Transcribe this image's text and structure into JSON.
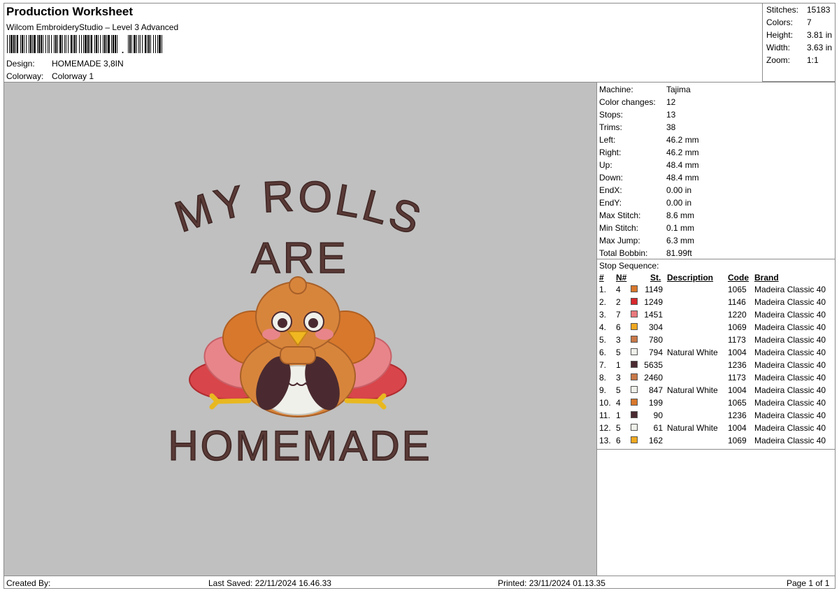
{
  "header": {
    "title": "Production Worksheet",
    "software": "Wilcom EmbroideryStudio – Level 3 Advanced",
    "design_label": "Design:",
    "design_value": "HOMEMADE 3,8IN",
    "colorway_label": "Colorway:",
    "colorway_value": "Colorway 1"
  },
  "summary": [
    {
      "label": "Stitches:",
      "value": "15183"
    },
    {
      "label": "Colors:",
      "value": "7"
    },
    {
      "label": "Height:",
      "value": "3.81 in"
    },
    {
      "label": "Width:",
      "value": "3.63 in"
    },
    {
      "label": "Zoom:",
      "value": "1:1"
    }
  ],
  "machine_info": [
    {
      "label": "Machine:",
      "value": "Tajima"
    },
    {
      "label": "Color changes:",
      "value": "12"
    },
    {
      "label": "Stops:",
      "value": "13"
    },
    {
      "label": "Trims:",
      "value": "38"
    },
    {
      "label": "Left:",
      "value": "46.2 mm"
    },
    {
      "label": "Right:",
      "value": "46.2 mm"
    },
    {
      "label": "Up:",
      "value": "48.4 mm"
    },
    {
      "label": "Down:",
      "value": "48.4 mm"
    },
    {
      "label": "EndX:",
      "value": "0.00 in"
    },
    {
      "label": "EndY:",
      "value": "0.00 in"
    },
    {
      "label": "Max Stitch:",
      "value": "8.6 mm"
    },
    {
      "label": "Min Stitch:",
      "value": "0.1 mm"
    },
    {
      "label": "Max Jump:",
      "value": "6.3 mm"
    },
    {
      "label": "Total Bobbin:",
      "value": "81.99ft"
    }
  ],
  "stop_sequence": {
    "title": "Stop Sequence:",
    "columns": {
      "num": "#",
      "n": "N#",
      "st": "St.",
      "desc": "Description",
      "code": "Code",
      "brand": "Brand"
    },
    "rows": [
      {
        "num": "1.",
        "n": "4",
        "color": "#d8782c",
        "st": "1149",
        "desc": "",
        "code": "1065",
        "brand": "Madeira Classic 40"
      },
      {
        "num": "2.",
        "n": "2",
        "color": "#d8282c",
        "st": "1249",
        "desc": "",
        "code": "1146",
        "brand": "Madeira Classic 40"
      },
      {
        "num": "3.",
        "n": "7",
        "color": "#e8787c",
        "st": "1451",
        "desc": "",
        "code": "1220",
        "brand": "Madeira Classic 40"
      },
      {
        "num": "4.",
        "n": "6",
        "color": "#f0a820",
        "st": "304",
        "desc": "",
        "code": "1069",
        "brand": "Madeira Classic 40"
      },
      {
        "num": "5.",
        "n": "3",
        "color": "#c87848",
        "st": "780",
        "desc": "",
        "code": "1173",
        "brand": "Madeira Classic 40"
      },
      {
        "num": "6.",
        "n": "5",
        "color": "#f0f0ea",
        "st": "794",
        "desc": "Natural White",
        "code": "1004",
        "brand": "Madeira Classic 40"
      },
      {
        "num": "7.",
        "n": "1",
        "color": "#4a2a30",
        "st": "5635",
        "desc": "",
        "code": "1236",
        "brand": "Madeira Classic 40"
      },
      {
        "num": "8.",
        "n": "3",
        "color": "#c87848",
        "st": "2460",
        "desc": "",
        "code": "1173",
        "brand": "Madeira Classic 40"
      },
      {
        "num": "9.",
        "n": "5",
        "color": "#f0f0ea",
        "st": "847",
        "desc": "Natural White",
        "code": "1004",
        "brand": "Madeira Classic 40"
      },
      {
        "num": "10.",
        "n": "4",
        "color": "#d8782c",
        "st": "199",
        "desc": "",
        "code": "1065",
        "brand": "Madeira Classic 40"
      },
      {
        "num": "11.",
        "n": "1",
        "color": "#4a2a30",
        "st": "90",
        "desc": "",
        "code": "1236",
        "brand": "Madeira Classic 40"
      },
      {
        "num": "12.",
        "n": "5",
        "color": "#f0f0ea",
        "st": "61",
        "desc": "Natural White",
        "code": "1004",
        "brand": "Madeira Classic 40"
      },
      {
        "num": "13.",
        "n": "6",
        "color": "#f0a820",
        "st": "162",
        "desc": "",
        "code": "1069",
        "brand": "Madeira Classic 40"
      }
    ]
  },
  "design_preview": {
    "line1": "MY ROLLS",
    "line2": "ARE",
    "line3": "HOMEMADE",
    "background": "#c0c0c0",
    "text_color": "#5a3a36"
  },
  "footer": {
    "created_by": "Created By:",
    "last_saved": "Last Saved: 22/11/2024 16.46.33",
    "printed": "Printed: 23/11/2024 01.13.35",
    "page": "Page 1 of 1"
  }
}
